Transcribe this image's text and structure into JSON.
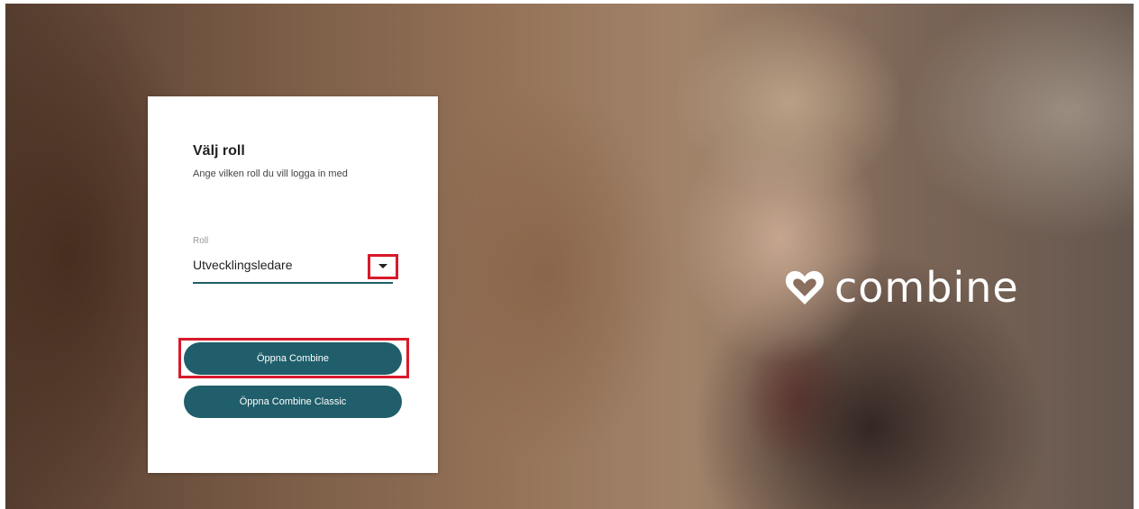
{
  "card": {
    "title": "Välj roll",
    "subtitle": "Ange vilken roll du vill logga in med",
    "role_field": {
      "label": "Roll",
      "selected": "Utvecklingsledare"
    },
    "buttons": {
      "open_combine": "Öppna Combine",
      "open_classic": "Öppna Combine Classic"
    }
  },
  "brand": {
    "logo_text": "combine",
    "logo_icon": "heart-icon"
  },
  "colors": {
    "accent": "#1f5e6a",
    "highlight": "#d8192a",
    "logo": "#ffffff"
  }
}
